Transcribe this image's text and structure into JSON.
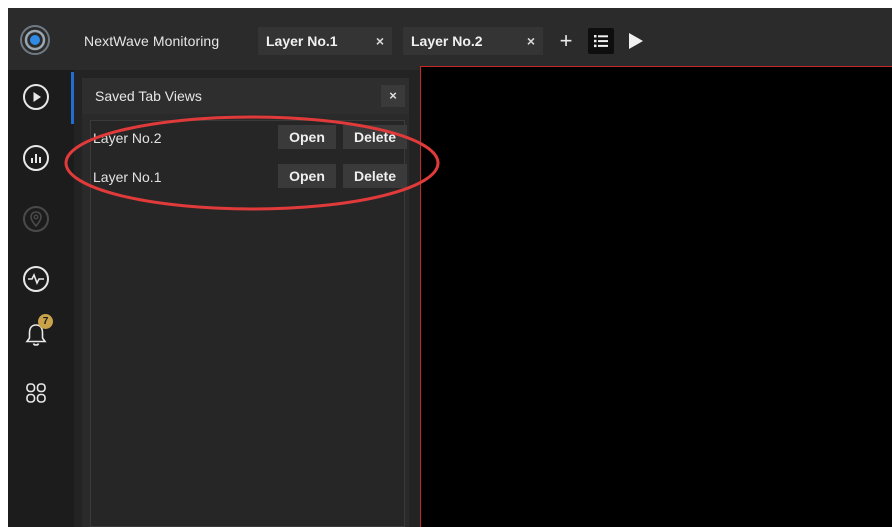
{
  "app": {
    "title": "NextWave Monitoring"
  },
  "tabs": [
    {
      "label": "Layer No.1",
      "close": "×"
    },
    {
      "label": "Layer No.2",
      "close": "×"
    }
  ],
  "toolbar": {
    "add": "+",
    "list_icon": "list-icon",
    "play_icon": "play-icon"
  },
  "sidebar": {
    "icons": [
      "play-circle-icon",
      "bar-chart-icon",
      "map-pin-icon",
      "heartbeat-icon",
      "bell-icon",
      "grid-icon"
    ],
    "notification_count": "7"
  },
  "saved_views": {
    "title": "Saved Tab Views",
    "close": "×",
    "items": [
      {
        "label": "Layer No.2",
        "open": "Open",
        "delete": "Delete"
      },
      {
        "label": "Layer No.1",
        "open": "Open",
        "delete": "Delete"
      }
    ]
  },
  "colors": {
    "accent": "#1e6fd0",
    "highlight": "#e03a3a",
    "canvas_border": "#c62828",
    "badge": "#c9a24a"
  }
}
